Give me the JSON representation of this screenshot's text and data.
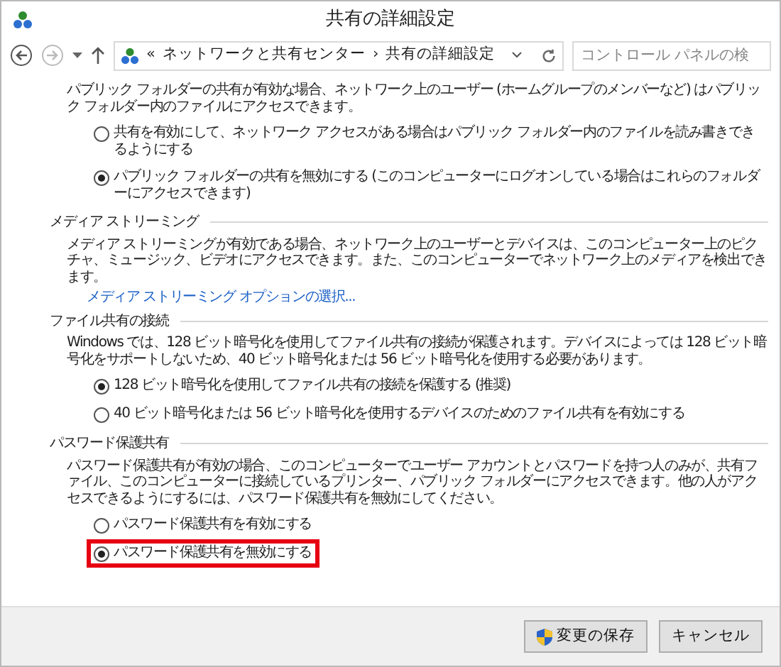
{
  "window": {
    "title": "共有の詳細設定"
  },
  "address_bar": {
    "overflow": "«",
    "separator": "›",
    "path": [
      {
        "label": "ネットワークと共有センター"
      },
      {
        "label": "共有の詳細設定"
      }
    ]
  },
  "search": {
    "placeholder": "コントロール パネルの検"
  },
  "sections": [
    {
      "paragraph": "パブリック フォルダーの共有が有効な場合、ネットワーク上のユーザー (ホームグループのメンバーなど) はパブリック フォルダー内のファイルにアクセスできます。",
      "options": [
        {
          "label": "共有を有効にして、ネットワーク アクセスがある場合はパブリック フォルダー内のファイルを読み書きできるようにする",
          "selected": false,
          "highlighted": false
        },
        {
          "label": "パブリック フォルダーの共有を無効にする (このコンピューターにログオンしている場合はこれらのフォルダーにアクセスできます)",
          "selected": true,
          "highlighted": false
        }
      ]
    },
    {
      "heading": "メディア ストリーミング",
      "paragraph": "メディア ストリーミングが有効である場合、ネットワーク上のユーザーとデバイスは、このコンピューター上のピクチャ、ミュージック、ビデオにアクセスできます。また、このコンピューターでネットワーク上のメディアを検出できます。",
      "link": "メディア ストリーミング オプションの選択..."
    },
    {
      "heading": "ファイル共有の接続",
      "paragraph": "Windows では、128 ビット暗号化を使用してファイル共有の接続が保護されます。デバイスによっては 128 ビット暗号化をサポートしないため、40 ビット暗号化または 56 ビット暗号化を使用する必要があります。",
      "options": [
        {
          "label": "128 ビット暗号化を使用してファイル共有の接続を保護する (推奨)",
          "selected": true,
          "highlighted": false
        },
        {
          "label": "40 ビット暗号化または 56 ビット暗号化を使用するデバイスのためのファイル共有を有効にする",
          "selected": false,
          "highlighted": false
        }
      ]
    },
    {
      "heading": "パスワード保護共有",
      "paragraph": "パスワード保護共有が有効の場合、このコンピューターでユーザー アカウントとパスワードを持つ人のみが、共有ファイル、このコンピューターに接続しているプリンター、パブリック フォルダーにアクセスできます。他の人がアクセスできるようにするには、パスワード保護共有を無効にしてください。",
      "options": [
        {
          "label": "パスワード保護共有を有効にする",
          "selected": false,
          "highlighted": false
        },
        {
          "label": "パスワード保護共有を無効にする",
          "selected": true,
          "highlighted": true
        }
      ]
    }
  ],
  "buttons": [
    {
      "label": "変更の保存",
      "kind": "shield"
    },
    {
      "label": "キャンセル",
      "kind": "plain"
    }
  ]
}
